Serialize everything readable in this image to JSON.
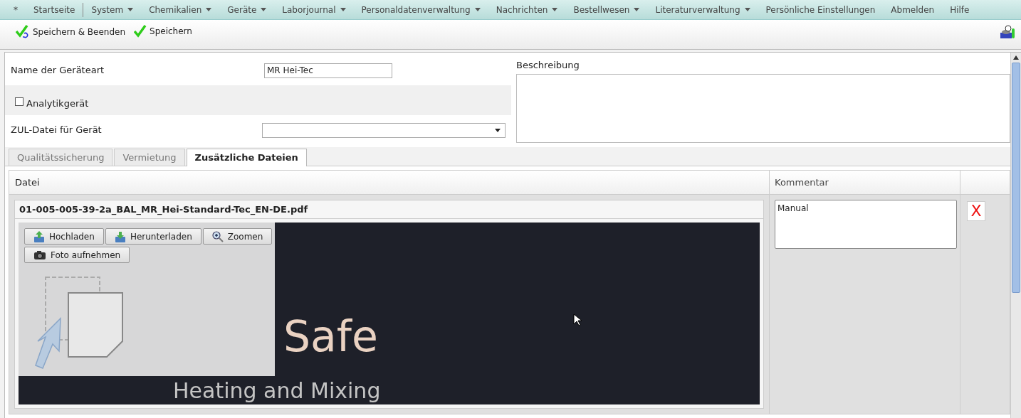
{
  "menu": [
    {
      "label": "*",
      "dropdown": false
    },
    {
      "label": "Startseite",
      "dropdown": false
    },
    {
      "label": "System",
      "dropdown": true
    },
    {
      "label": "Chemikalien",
      "dropdown": true
    },
    {
      "label": "Geräte",
      "dropdown": true
    },
    {
      "label": "Laborjournal",
      "dropdown": true
    },
    {
      "label": "Personaldatenverwaltung",
      "dropdown": true
    },
    {
      "label": "Nachrichten",
      "dropdown": true
    },
    {
      "label": "Bestellwesen",
      "dropdown": true
    },
    {
      "label": "Literaturverwaltung",
      "dropdown": true
    },
    {
      "label": "Persönliche Einstellungen",
      "dropdown": false
    },
    {
      "label": "Abmelden",
      "dropdown": false
    },
    {
      "label": "Hilfe",
      "dropdown": false
    }
  ],
  "toolbar": [
    {
      "label": "Speichern & Beenden",
      "kind": "save-close"
    },
    {
      "label": "Speichern",
      "kind": "save"
    }
  ],
  "form": {
    "name_label": "Name der Geräteart",
    "name_value": "MR Hei-Tec",
    "analytic_label": "Analytikgerät",
    "analytic_checked": false,
    "zul_label": "ZUL-Datei für Gerät",
    "description_label": "Beschreibung"
  },
  "tabs": [
    {
      "label": "Qualitätssicherung",
      "selected": false
    },
    {
      "label": "Vermietung",
      "selected": false
    },
    {
      "label": "Zusätzliche Dateien",
      "selected": true
    }
  ],
  "table": {
    "columns": [
      "Datei",
      "Kommentar"
    ],
    "rows": [
      {
        "filename": "01-005-005-39-2a_BAL_MR_Hei-Standard-Tec_EN-DE.pdf",
        "buttons": [
          {
            "label": "Hochladen",
            "kind": "upload"
          },
          {
            "label": "Herunterladen",
            "kind": "download"
          },
          {
            "label": "Zoomen",
            "kind": "zoom"
          },
          {
            "label": "Foto aufnehmen",
            "kind": "camera"
          }
        ],
        "preview": {
          "title": "Safe",
          "subtitle": "Heating and Mixing"
        },
        "comment": "Manual",
        "delete": "X"
      }
    ]
  }
}
